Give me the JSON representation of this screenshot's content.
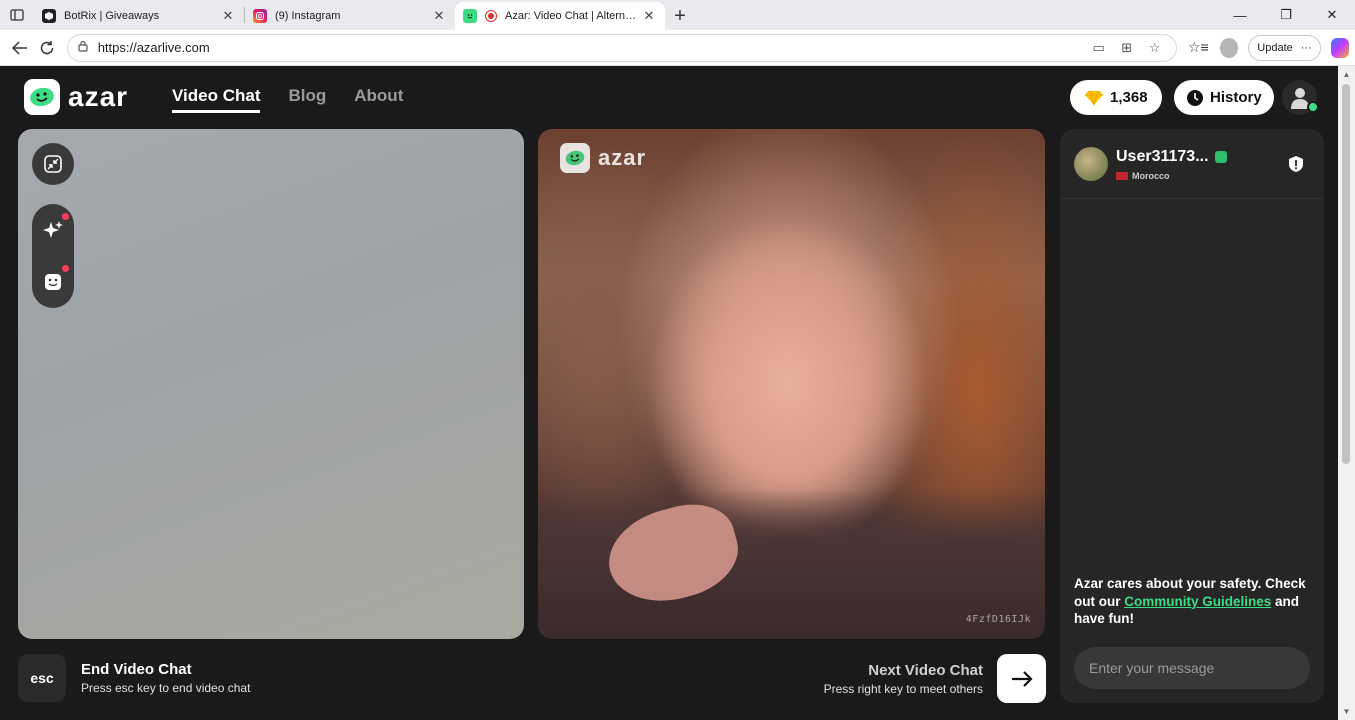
{
  "browser": {
    "tabs": [
      {
        "title": "BotRix | Giveaways",
        "favicon": "botrix-icon",
        "active": false
      },
      {
        "title": "(9) Instagram",
        "favicon": "instagram-icon",
        "active": false
      },
      {
        "title": "Azar: Video Chat | Alternative",
        "favicon": "azar-icon",
        "active": true
      }
    ],
    "url": "https://azarlive.com",
    "update_label": "Update"
  },
  "nav": {
    "logo_text": "azar",
    "links": [
      "Video Chat",
      "Blog",
      "About"
    ],
    "gems": "1,368",
    "history_label": "History"
  },
  "remote_video": {
    "logo_text": "azar",
    "code": "4FzfD16IJk"
  },
  "peer": {
    "name": "User31173...",
    "country": "Morocco"
  },
  "safety": {
    "line1": "Azar cares about your safety. Check out our ",
    "link": "Community Guidelines",
    "line2": " and have fun!"
  },
  "chat": {
    "placeholder": "Enter your message"
  },
  "controls": {
    "esc_key": "esc",
    "end_title": "End Video Chat",
    "end_sub": "Press esc key to end video chat",
    "next_title": "Next Video Chat",
    "next_sub": "Press right key to meet others"
  },
  "colors": {
    "accent": "#3ddc84",
    "bg": "#1a1a1a",
    "panel": "#262626"
  }
}
